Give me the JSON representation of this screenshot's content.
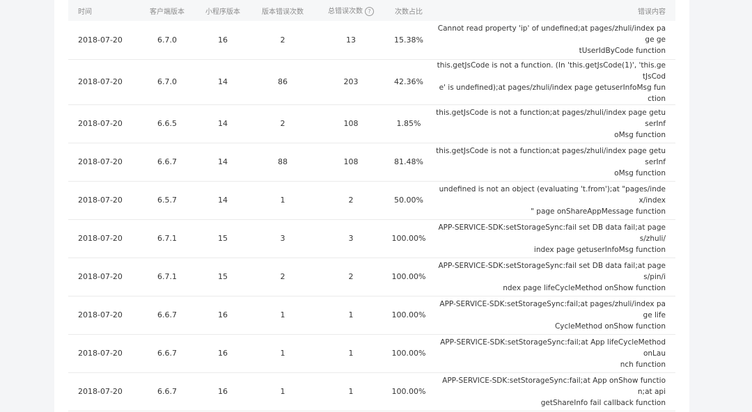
{
  "columns": {
    "time": "时间",
    "client_version": "客户端版本",
    "mini_version": "小程序版本",
    "version_errors": "版本错误次数",
    "total_errors": "总错误次数",
    "ratio": "次数占比",
    "error_message": "错误内容"
  },
  "rows": [
    {
      "time": "2018-07-20",
      "client_version": "6.7.0",
      "mini_version": "16",
      "version_errors": "2",
      "total_errors": "13",
      "ratio": "15.38%",
      "line1": "Cannot read property 'ip' of undefined;at pages/zhuli/index page ge",
      "line2": "tUserIdByCode function"
    },
    {
      "time": "2018-07-20",
      "client_version": "6.7.0",
      "mini_version": "14",
      "version_errors": "86",
      "total_errors": "203",
      "ratio": "42.36%",
      "line1": "this.getJsCode is not a function. (In 'this.getJsCode(1)', 'this.getJsCod",
      "line2": "e' is undefined);at pages/zhuli/index page getuserInfoMsg function"
    },
    {
      "time": "2018-07-20",
      "client_version": "6.6.5",
      "mini_version": "14",
      "version_errors": "2",
      "total_errors": "108",
      "ratio": "1.85%",
      "line1": "this.getJsCode is not a function;at pages/zhuli/index page getuserInf",
      "line2": "oMsg function"
    },
    {
      "time": "2018-07-20",
      "client_version": "6.6.7",
      "mini_version": "14",
      "version_errors": "88",
      "total_errors": "108",
      "ratio": "81.48%",
      "line1": "this.getJsCode is not a function;at pages/zhuli/index page getuserInf",
      "line2": "oMsg function"
    },
    {
      "time": "2018-07-20",
      "client_version": "6.5.7",
      "mini_version": "14",
      "version_errors": "1",
      "total_errors": "2",
      "ratio": "50.00%",
      "line1": "undefined is not an object (evaluating 't.from');at \"pages/index/index",
      "line2": "\" page onShareAppMessage function"
    },
    {
      "time": "2018-07-20",
      "client_version": "6.7.1",
      "mini_version": "15",
      "version_errors": "3",
      "total_errors": "3",
      "ratio": "100.00%",
      "line1": "APP-SERVICE-SDK:setStorageSync:fail set DB data fail;at pages/zhuli/",
      "line2": "index page getuserInfoMsg function"
    },
    {
      "time": "2018-07-20",
      "client_version": "6.7.1",
      "mini_version": "15",
      "version_errors": "2",
      "total_errors": "2",
      "ratio": "100.00%",
      "line1": "APP-SERVICE-SDK:setStorageSync:fail set DB data fail;at pages/pin/i",
      "line2": "ndex page lifeCycleMethod onShow function"
    },
    {
      "time": "2018-07-20",
      "client_version": "6.6.7",
      "mini_version": "16",
      "version_errors": "1",
      "total_errors": "1",
      "ratio": "100.00%",
      "line1": "APP-SERVICE-SDK:setStorageSync:fail;at pages/zhuli/index page life",
      "line2": "CycleMethod onShow function"
    },
    {
      "time": "2018-07-20",
      "client_version": "6.6.7",
      "mini_version": "16",
      "version_errors": "1",
      "total_errors": "1",
      "ratio": "100.00%",
      "line1": "APP-SERVICE-SDK:setStorageSync:fail;at App lifeCycleMethod onLau",
      "line2": "nch function"
    },
    {
      "time": "2018-07-20",
      "client_version": "6.6.7",
      "mini_version": "16",
      "version_errors": "1",
      "total_errors": "1",
      "ratio": "100.00%",
      "line1": "APP-SERVICE-SDK:setStorageSync:fail;at App onShow function;at api",
      "line2": "getShareInfo fail callback function"
    }
  ],
  "icons": {
    "help": "question-circle-icon"
  },
  "colors": {
    "header_bg": "#f6f7f8",
    "header_text": "#8c8c8c",
    "body_text": "#353535",
    "page_bg": "#f4f5f7"
  }
}
